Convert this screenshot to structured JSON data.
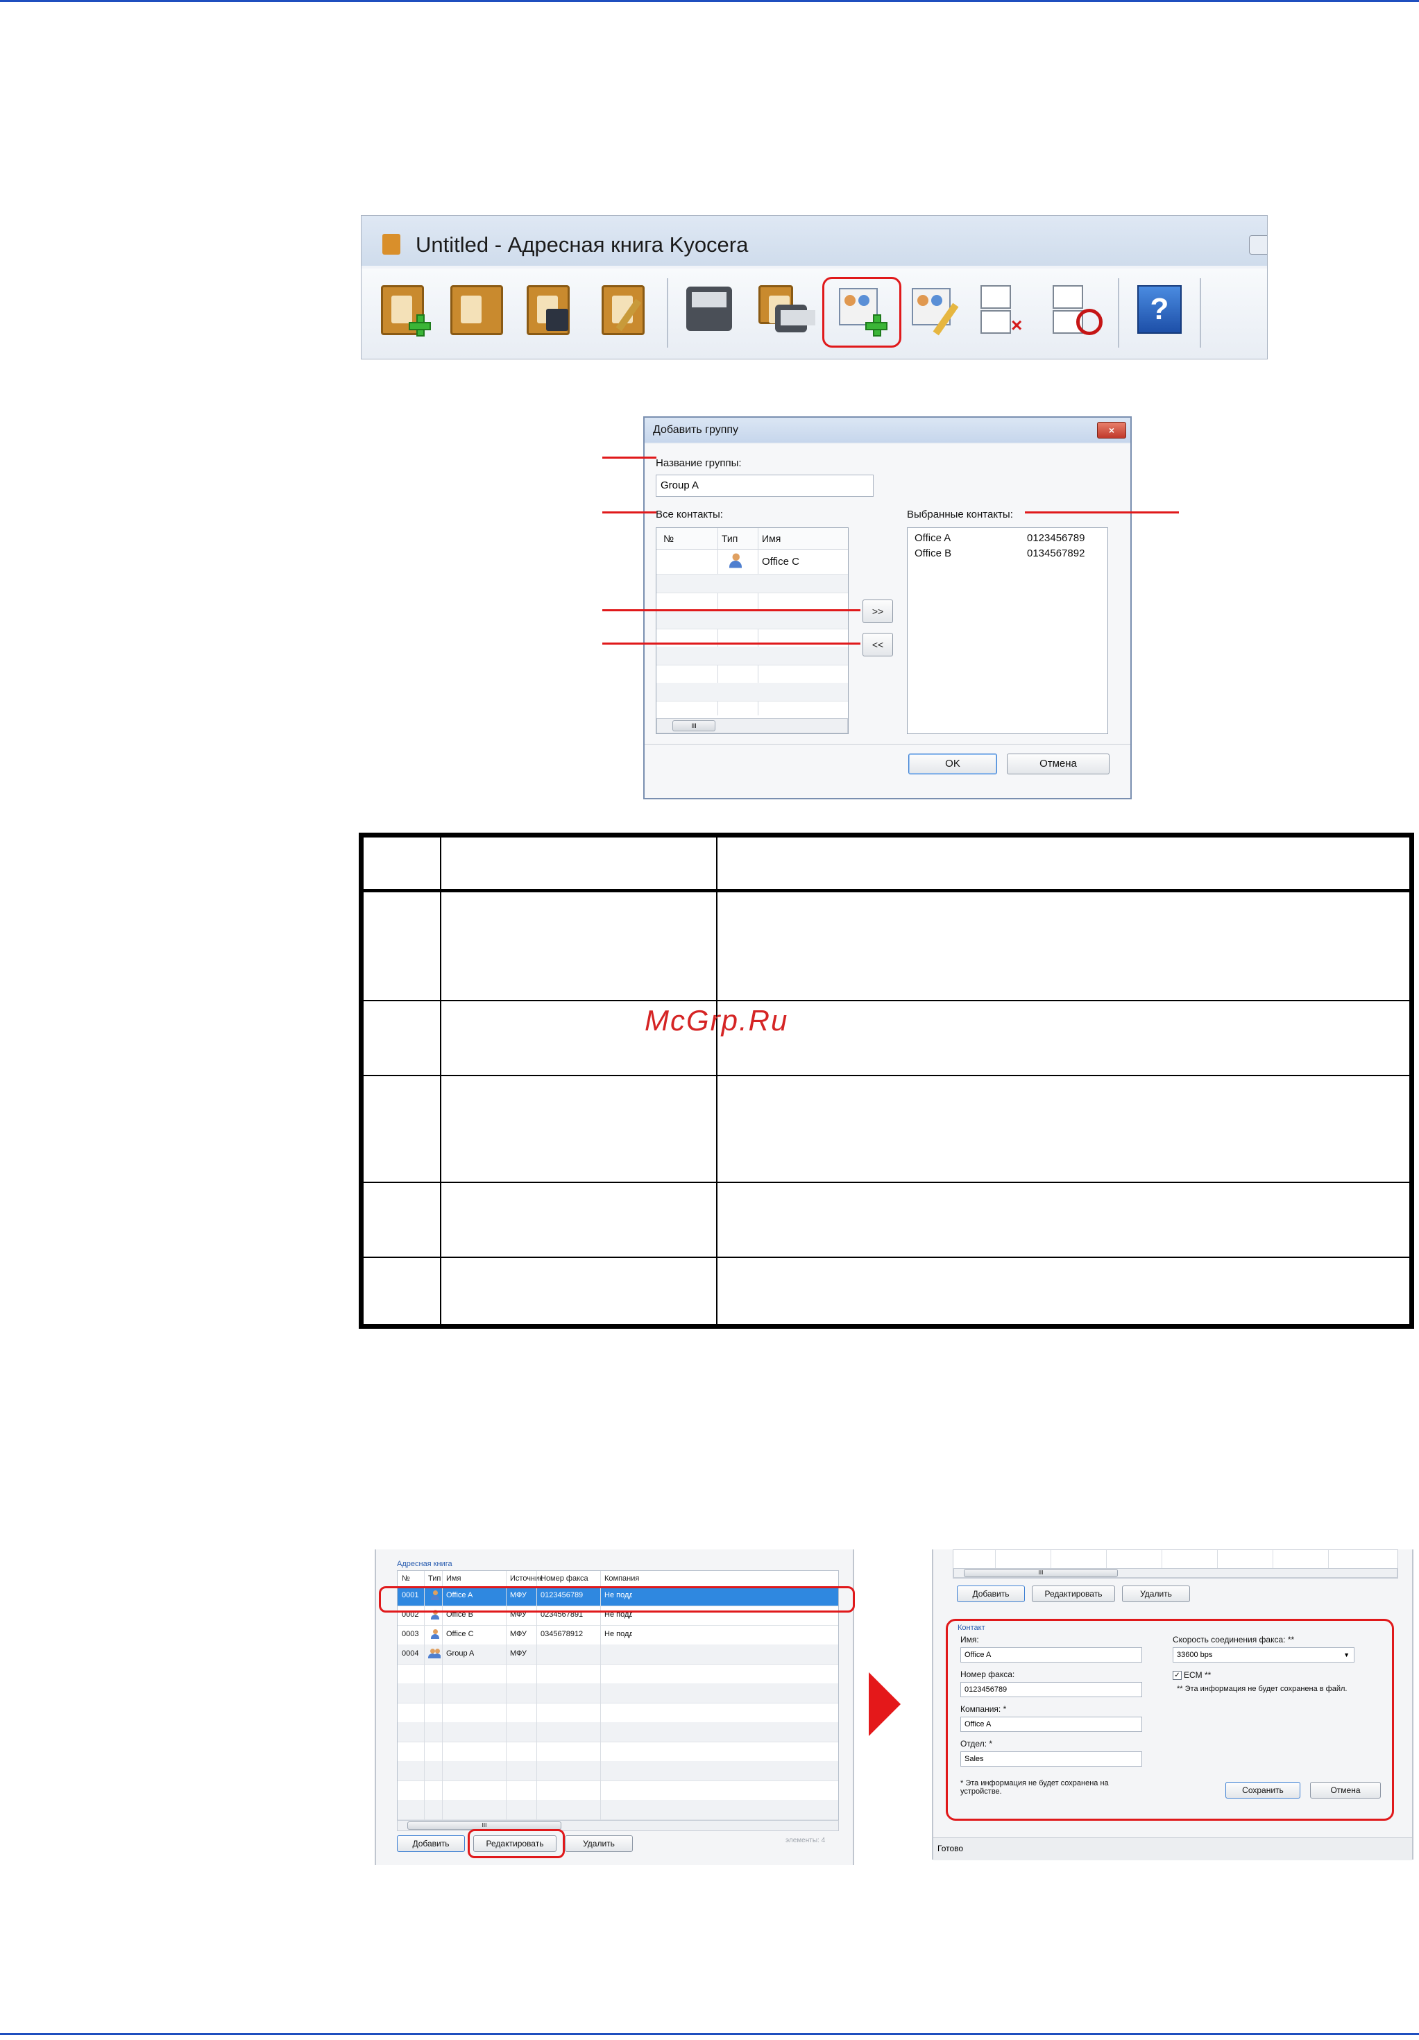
{
  "toolbar_window": {
    "title": "Untitled - Адресная книга Kyocera",
    "icons": [
      "add-contact-book-icon",
      "open-address-book-icon",
      "save-address-book-icon",
      "edit-address-book-icon",
      "device-address-book-icon",
      "transfer-to-device-icon",
      "add-group-icon",
      "edit-contact-icon",
      "delete-contact-icon",
      "clear-contacts-icon",
      "help-icon"
    ]
  },
  "add_group_dialog": {
    "title": "Добавить группу",
    "close_label": "×",
    "group_name_label": "Название группы:",
    "group_name_value": "Group A",
    "all_contacts_label": "Все контакты:",
    "all_contacts_columns": [
      "№",
      "Тип",
      "Имя"
    ],
    "all_contacts_rows": [
      {
        "no": "",
        "type_icon": "person-icon",
        "name": "Office C"
      }
    ],
    "scroll_grip": "III",
    "add_button": ">>",
    "remove_button": "<<",
    "selected_contacts_label": "Выбранные контакты:",
    "selected_contacts": [
      {
        "name": "Office A",
        "number": "0123456789"
      },
      {
        "name": "Office B",
        "number": "0134567892"
      }
    ],
    "ok_button": "OK",
    "cancel_button": "Отмена"
  },
  "table": {
    "watermark": "McGrp.Ru"
  },
  "address_book_panel": {
    "section_title": "Адресная книга",
    "columns": [
      "№",
      "Тип",
      "Имя",
      "Источник",
      "Номер факса",
      "Компания"
    ],
    "rows": [
      {
        "no": "0001",
        "type_icon": "person-icon",
        "name": "Office A",
        "source": "МФУ",
        "fax": "0123456789",
        "company": "Не поддержи"
      },
      {
        "no": "0002",
        "type_icon": "person-icon",
        "name": "Office B",
        "source": "МФУ",
        "fax": "0234567891",
        "company": "Не поддержив"
      },
      {
        "no": "0003",
        "type_icon": "person-icon",
        "name": "Office C",
        "source": "МФУ",
        "fax": "0345678912",
        "company": "Не поддержив"
      },
      {
        "no": "0004",
        "type_icon": "group-icon",
        "name": "Group A",
        "source": "МФУ",
        "fax": "",
        "company": ""
      }
    ],
    "selected_row": "0001",
    "scroll_grip": "III",
    "add_button": "Добавить",
    "edit_button": "Редактировать",
    "delete_button": "Удалить",
    "items_counter": "элементы: 4"
  },
  "edit_panel": {
    "add_button": "Добавить",
    "edit_button": "Редактировать",
    "delete_button": "Удалить",
    "scroll_grip": "III",
    "group_title": "Контакт",
    "name_label": "Имя:",
    "name_value": "Office A",
    "fax_label": "Номер факса:",
    "fax_value": "0123456789",
    "company_label": "Компания: *",
    "company_value": "Office A",
    "department_label": "Отдел: *",
    "department_value": "Sales",
    "footnote_1": "* Эта информация не будет сохранена на устройстве.",
    "speed_label": "Скорость соединения факса: **",
    "speed_value": "33600 bps",
    "ecm_label": "ECM **",
    "ecm_checked": true,
    "footnote_2": "** Эта информация не будет сохранена в файл.",
    "save_button": "Сохранить",
    "cancel_button": "Отмена",
    "status_text": "Готово"
  },
  "colors": {
    "accent_rule": "#1f4fbf",
    "highlight_red": "#e0191b",
    "selection_blue": "#2f88e0"
  }
}
